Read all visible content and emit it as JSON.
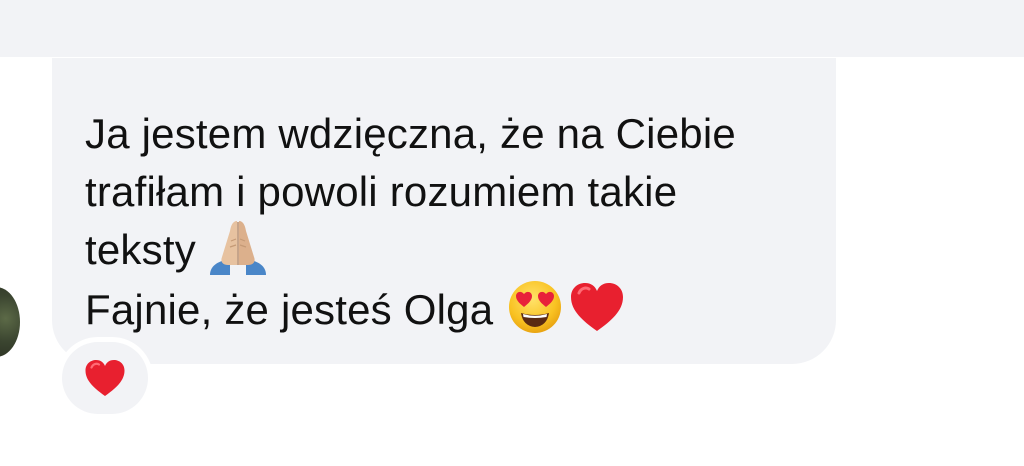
{
  "previous_message": {
    "color": "#f2f3f6"
  },
  "message": {
    "lines": [
      "Ja jestem wdzięczna, że na Ciebie",
      "trafiłam i powoli rozumiem takie",
      "teksty",
      "Fajnie, że jesteś Olga"
    ],
    "line3_emoji": "praying-hands-icon",
    "line4_emojis": [
      "smiling-face-with-heart-eyes-icon",
      "red-heart-icon"
    ],
    "bubble_color": "#f2f3f6",
    "text_color": "#111111"
  },
  "reaction": {
    "emoji": "red-heart-icon",
    "color": "#e0202e"
  },
  "sender": {
    "avatar": "avatar"
  }
}
